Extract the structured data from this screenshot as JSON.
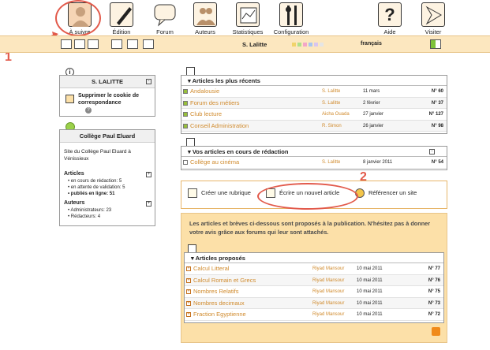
{
  "toolbar": {
    "items": [
      {
        "label": "À suivre",
        "icon": "person-icon"
      },
      {
        "label": "Édition",
        "icon": "pen-icon"
      },
      {
        "label": "Forum",
        "icon": "speech-bubble-icon"
      },
      {
        "label": "Auteurs",
        "icon": "people-icon"
      },
      {
        "label": "Statistiques",
        "icon": "chart-icon"
      },
      {
        "label": "Configuration",
        "icon": "tools-icon"
      },
      {
        "label": "Aide",
        "icon": "help-icon"
      },
      {
        "label": "Visiter",
        "icon": "arrow-icon"
      }
    ]
  },
  "statusbar": {
    "user": "S. Lalitte",
    "language": "français"
  },
  "annotations": {
    "first": "1",
    "second": "2"
  },
  "user_box": {
    "title": "S. LALITTE",
    "remove_cookie": "Supprimer le cookie de correspondance",
    "help_mark": "?"
  },
  "site_box": {
    "title": "Collège Paul Eluard",
    "description": "Site du Collège Paul Eluard à Vénissieux",
    "articles_heading": "Articles",
    "articles": [
      {
        "text": "en cours de rédaction: 5",
        "bold": false
      },
      {
        "text": "en attente de validation: 5",
        "bold": false
      },
      {
        "text": "publiés en ligne: 51",
        "bold": true
      }
    ],
    "authors_heading": "Auteurs",
    "authors": [
      {
        "text": "Administrateurs: 23"
      },
      {
        "text": "Rédacteurs: 4"
      }
    ]
  },
  "recent": {
    "heading": "Articles les plus récents",
    "rows": [
      {
        "title": "Andalousie",
        "author": "S. Lalitte",
        "date": "11 mars",
        "num": "N° 60",
        "color": "#97bf3b"
      },
      {
        "title": "Forum des métiers",
        "author": "S. Lalitte",
        "date": "2 février",
        "num": "N° 37",
        "color": "#97bf3b"
      },
      {
        "title": "Club lecture",
        "author": "Aicha Ouada",
        "date": "27 janvier",
        "num": "N° 127",
        "color": "#97bf3b"
      },
      {
        "title": "Conseil Administration",
        "author": "R. Simon",
        "date": "26 janvier",
        "num": "N° 98",
        "color": "#97bf3b"
      }
    ]
  },
  "draft": {
    "heading": "Vos articles en cours de rédaction",
    "rows": [
      {
        "title": "Collège au cinéma",
        "author": "S. Lalitte",
        "date": "8 janvier 2011",
        "num": "N° 54",
        "color": "#ffffff"
      }
    ]
  },
  "actions": {
    "create_section": "Créer une rubrique",
    "write_article": "Écrire un nouvel article",
    "reference_site": "Référencer un site"
  },
  "proposed": {
    "intro": "Les articles et brèves ci-dessous sont proposés à la publication. N'hésitez pas à donner votre avis grâce aux forums qui leur sont attachés.",
    "heading": "Articles proposés",
    "rows": [
      {
        "title": "Calcul Litteral",
        "author": "Riyad Mansour",
        "date": "10 mai 2011",
        "num": "N° 77"
      },
      {
        "title": "Calcul Romain et Grecs",
        "author": "Riyad Mansour",
        "date": "10 mai 2011",
        "num": "N° 76"
      },
      {
        "title": "Nombres Relatifs",
        "author": "Riyad Mansour",
        "date": "10 mai 2011",
        "num": "N° 75"
      },
      {
        "title": "Nombres decimaux",
        "author": "Riyad Mansour",
        "date": "10 mai 2011",
        "num": "N° 73"
      },
      {
        "title": "Fraction Egyptienne",
        "author": "Riyad Mansour",
        "date": "10 mai 2011",
        "num": "N° 72"
      }
    ]
  },
  "colors": {
    "accent": "#d08a2c",
    "annotation": "#e25a4b",
    "bar": "#fce7bf"
  }
}
